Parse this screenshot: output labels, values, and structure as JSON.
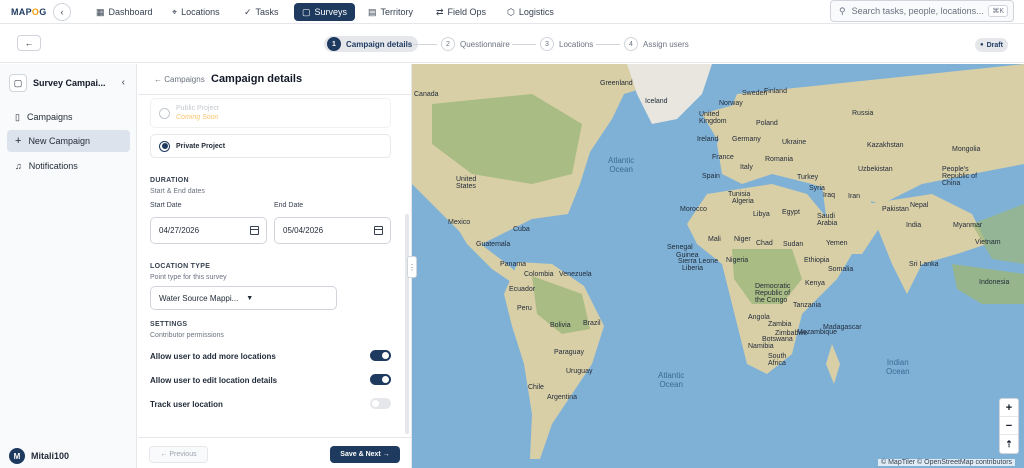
{
  "app": {
    "logo_main": "MAP",
    "logo_accent": "O",
    "logo_end": "G"
  },
  "nav": {
    "dashboard": "Dashboard",
    "locations": "Locations",
    "tasks": "Tasks",
    "surveys": "Surveys",
    "territory": "Territory",
    "field_ops": "Field Ops",
    "logistics": "Logistics"
  },
  "search": {
    "placeholder": "Search tasks, people, locations...",
    "shortcut": "⌘K"
  },
  "steps": [
    {
      "num": "1",
      "label": "Campaign details"
    },
    {
      "num": "2",
      "label": "Questionnaire"
    },
    {
      "num": "3",
      "label": "Locations"
    },
    {
      "num": "4",
      "label": "Assign users"
    }
  ],
  "status_badge": "Draft",
  "sidebar": {
    "title": "Survey Campai...",
    "items": [
      {
        "label": "Campaigns"
      },
      {
        "label": "New Campaign"
      },
      {
        "label": "Notifications"
      }
    ],
    "user": {
      "initial": "M",
      "name": "Mitali100"
    }
  },
  "panel": {
    "back": "← Campaigns",
    "title": "Campaign details",
    "public_project": "Public Project",
    "coming_soon": "Coming Soon",
    "private_project": "Private Project",
    "duration_title": "DURATION",
    "duration_sub": "Start & End dates",
    "start_label": "Start Date",
    "start_value": "04/27/2026",
    "end_label": "End Date",
    "end_value": "05/04/2026",
    "location_type_title": "LOCATION TYPE",
    "location_type_sub": "Point type for this survey",
    "location_type_value": "Water Source Mappi...",
    "settings_title": "SETTINGS",
    "settings_sub": "Contributor permissions",
    "toggle_add": "Allow user to add more locations",
    "toggle_add_on": true,
    "toggle_edit": "Allow user to edit location details",
    "toggle_edit_on": true,
    "toggle_track": "Track user location",
    "toggle_track_on": false,
    "prev": "← Previous",
    "next": "Save & Next →"
  },
  "map": {
    "labels": [
      "Canada",
      "United States",
      "Mexico",
      "Cuba",
      "Guatemala",
      "Panama",
      "Colombia",
      "Venezuela",
      "Ecuador",
      "Peru",
      "Brazil",
      "Bolivia",
      "Paraguay",
      "Uruguay",
      "Chile",
      "Argentina",
      "Greenland",
      "Iceland",
      "Sweden",
      "Norway",
      "Finland",
      "Russia",
      "United Kingdom",
      "Ireland",
      "Poland",
      "Germany",
      "France",
      "Spain",
      "Ukraine",
      "Romania",
      "Italy",
      "Turkey",
      "Kazakhstan",
      "Mongolia",
      "Uzbekistan",
      "China",
      "People's Republic of China",
      "Iran",
      "Iraq",
      "Syria",
      "Pakistan",
      "India",
      "Nepal",
      "Myanmar",
      "Vietnam",
      "Sri Lanka",
      "Saudi Arabia",
      "Yemen",
      "Egypt",
      "Libya",
      "Algeria",
      "Morocco",
      "Tunisia",
      "Mali",
      "Niger",
      "Chad",
      "Sudan",
      "Senegal",
      "Guinea",
      "Sierra Leone",
      "Liberia",
      "Nigeria",
      "Ethiopia",
      "Somalia",
      "Kenya",
      "Democratic Republic of the Congo",
      "Tanzania",
      "Angola",
      "Zambia",
      "Zimbabwe",
      "Namibia",
      "Botswana",
      "Mozambique",
      "Madagascar",
      "South Africa",
      "Indonesia"
    ],
    "oceans": {
      "atlantic_n": "Atlantic\nOcean",
      "atlantic_s": "Atlantic\nOcean",
      "indian": "Indian\nOcean"
    },
    "zoom_in": "+",
    "zoom_out": "−",
    "compass": "⇡",
    "attribution": "© MapTiler © OpenStreetMap contributors"
  },
  "colors": {
    "primary": "#1e3a5f",
    "ocean": "#7fb1d6",
    "land": "#d9cfa7",
    "forest": "#9cb77a"
  }
}
